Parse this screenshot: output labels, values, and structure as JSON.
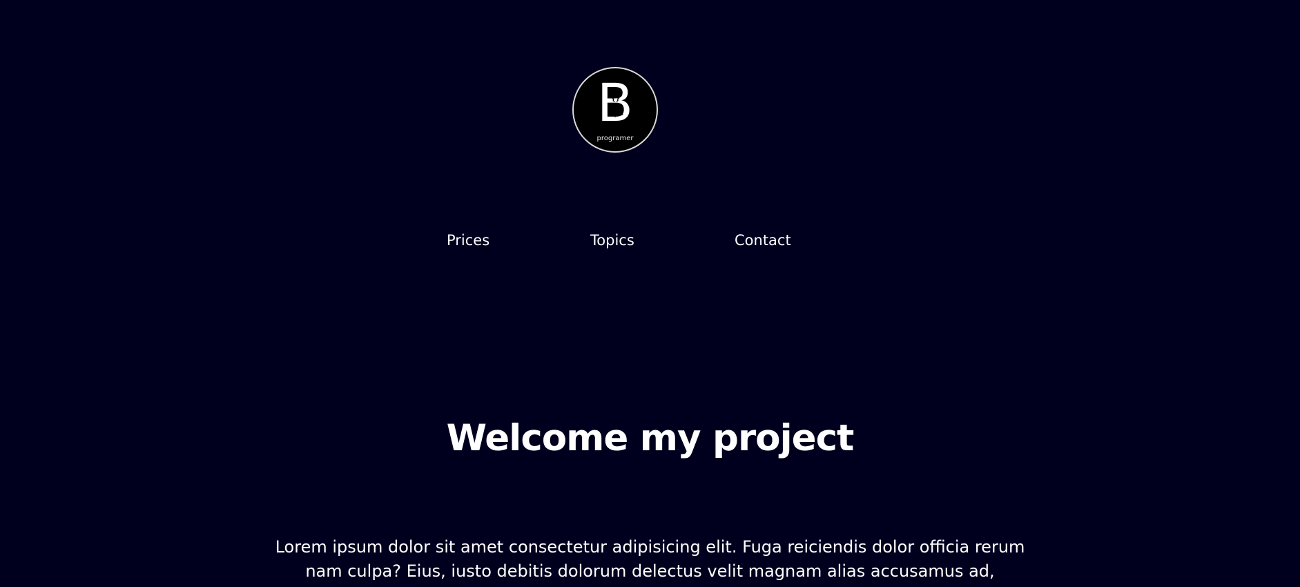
{
  "logo": {
    "letter": "B",
    "mark_top": "{}",
    "mark_bottom": "</>",
    "subtitle": "programer"
  },
  "nav": {
    "items": [
      {
        "label": "Prices"
      },
      {
        "label": "Topics"
      },
      {
        "label": "Contact"
      }
    ]
  },
  "hero": {
    "title": "Welcome my project",
    "text": "Lorem ipsum dolor sit amet consectetur adipisicing elit. Fuga reiciendis dolor officia rerum nam culpa? Eius, iusto debitis dolorum delectus velit magnam alias accusamus ad,"
  },
  "colors": {
    "background": "#00001e",
    "text": "#ffffff",
    "logo_ring": "#d8d8d8"
  }
}
